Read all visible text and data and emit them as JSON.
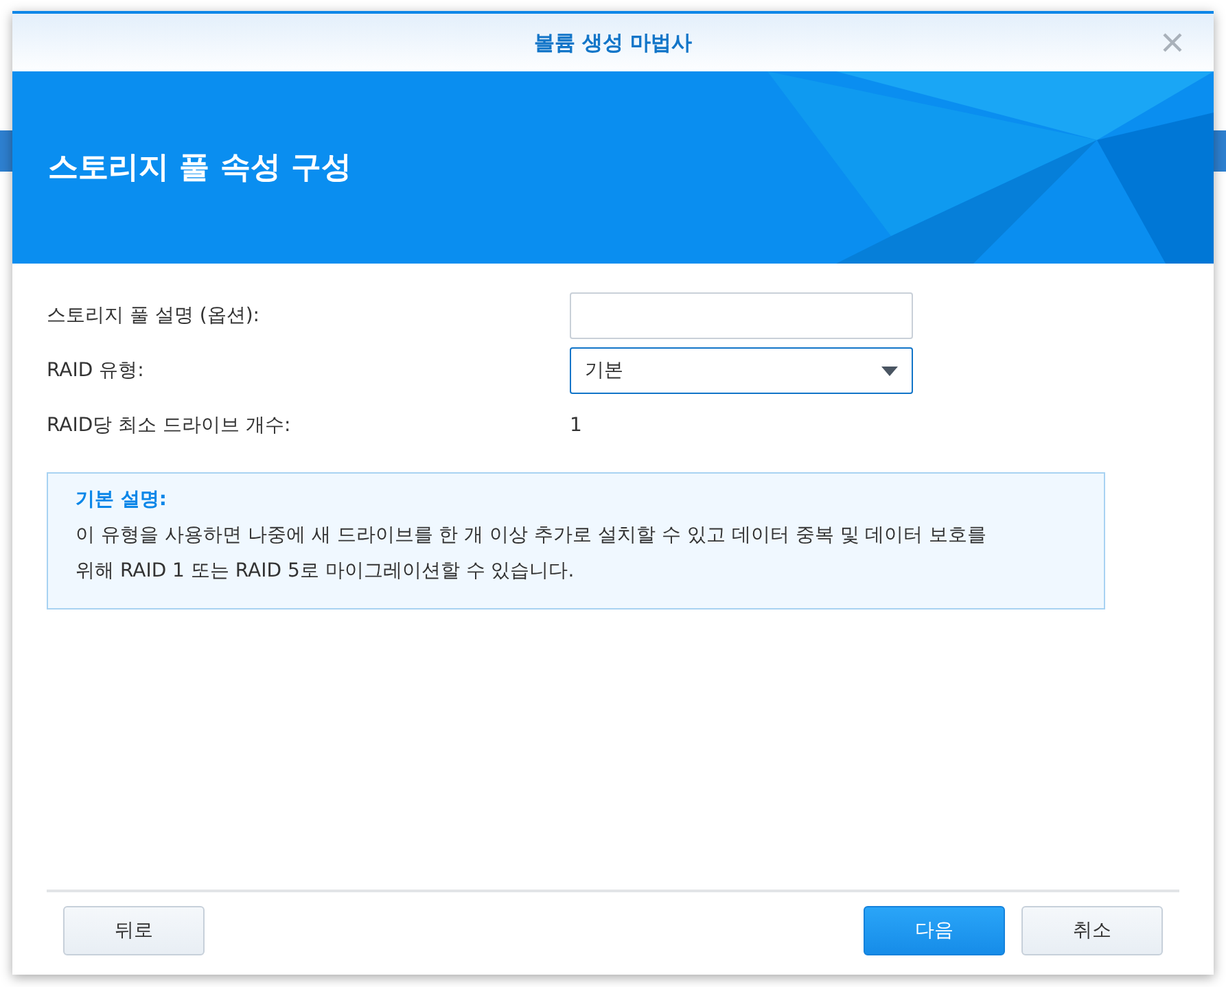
{
  "window": {
    "title": "볼륨 생성 마법사"
  },
  "header": {
    "title": "스토리지 풀 속성 구성"
  },
  "form": [
    {
      "kind": "input",
      "label": "스토리지 풀 설명 (옵션):"
    },
    {
      "kind": "select",
      "label": "RAID 유형:",
      "value": "기본"
    },
    {
      "kind": "text",
      "label": "RAID당 최소 드라이브 개수:",
      "value": "1"
    }
  ],
  "info": {
    "title": "기본 설명:",
    "text": "이 유형을 사용하면 나중에 새 드라이브를 한 개 이상 추가로 설치할 수 있고 데이터 중복 및 데이터 보호를 위해 RAID 1 또는 RAID 5로 마이그레이션할 수 있습니다."
  },
  "buttons": {
    "left": [
      {
        "label": "뒤로",
        "primary": false
      }
    ],
    "right": [
      {
        "label": "다음",
        "primary": true
      },
      {
        "label": "취소",
        "primary": false
      }
    ]
  }
}
